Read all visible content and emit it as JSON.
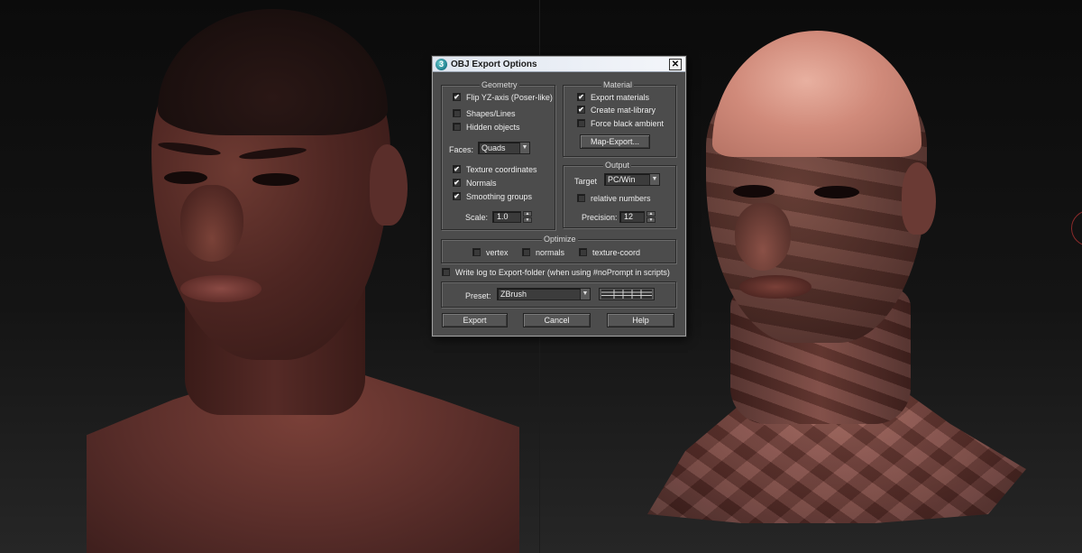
{
  "dialog": {
    "title": "OBJ Export Options",
    "title_icon": "3ds-max-icon",
    "close_glyph": "✕",
    "geometry": {
      "legend": "Geometry",
      "flip_yz": {
        "label": "Flip YZ-axis (Poser-like)",
        "checked": true
      },
      "shapes_lines": {
        "label": "Shapes/Lines",
        "checked": false
      },
      "hidden_objects": {
        "label": "Hidden objects",
        "checked": false
      },
      "faces_label": "Faces:",
      "faces_value": "Quads",
      "texture_coords": {
        "label": "Texture coordinates",
        "checked": true
      },
      "normals": {
        "label": "Normals",
        "checked": true
      },
      "smoothing_groups": {
        "label": "Smoothing groups",
        "checked": true
      },
      "scale_label": "Scale:",
      "scale_value": "1.0"
    },
    "material": {
      "legend": "Material",
      "export_materials": {
        "label": "Export materials",
        "checked": true
      },
      "create_mat_library": {
        "label": "Create mat-library",
        "checked": true
      },
      "force_black_ambient": {
        "label": "Force black ambient",
        "checked": false
      },
      "map_export_label": "Map-Export..."
    },
    "output": {
      "legend": "Output",
      "target_label": "Target",
      "target_value": "PC/Win",
      "relative_numbers": {
        "label": "relative numbers",
        "checked": false
      },
      "precision_label": "Precision:",
      "precision_value": "12"
    },
    "optimize": {
      "legend": "Optimize",
      "vertex": {
        "label": "vertex",
        "checked": false
      },
      "normals": {
        "label": "normals",
        "checked": false
      },
      "texture_coord": {
        "label": "texture-coord",
        "checked": false
      }
    },
    "write_log": {
      "label": "Write log to Export-folder (when using #noPrompt in scripts)",
      "checked": false
    },
    "preset": {
      "label": "Preset:",
      "value": "ZBrush"
    },
    "buttons": {
      "export": "Export",
      "cancel": "Cancel",
      "help": "Help"
    },
    "dropdown_glyph": "▼",
    "spin_up_glyph": "▲",
    "spin_down_glyph": "▼"
  },
  "colors": {
    "dialog_bg": "#4c4c4c",
    "titlebar": "#e6ebf2",
    "skin_dark": "#4e2622",
    "scalp_highlight": "#d08a7a",
    "background": "#101010"
  }
}
